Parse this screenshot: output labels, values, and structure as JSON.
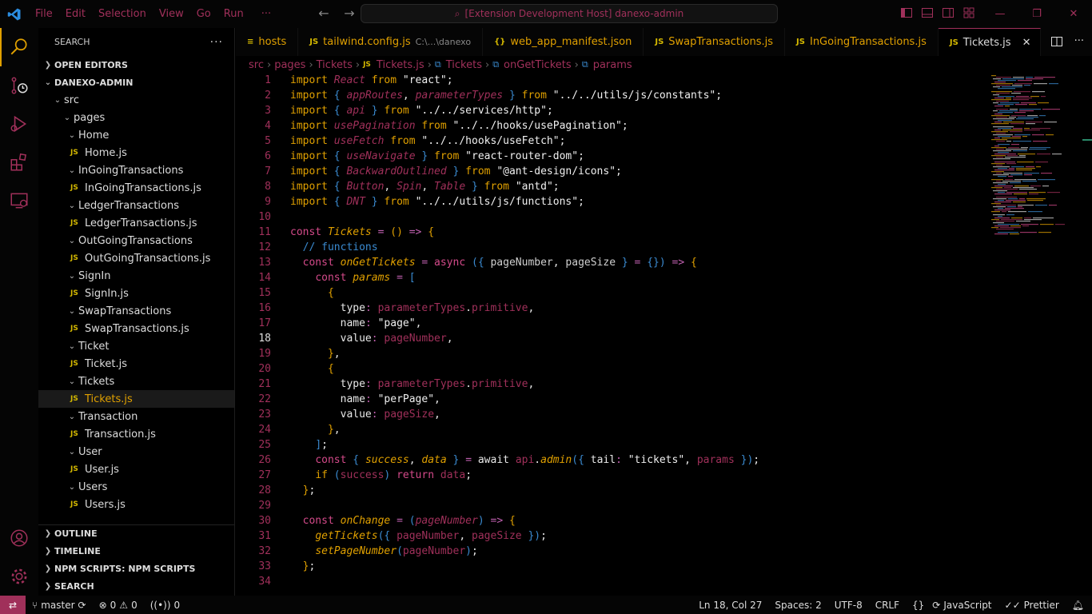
{
  "menu": [
    "File",
    "Edit",
    "Selection",
    "View",
    "Go",
    "Run",
    "···"
  ],
  "command_center": "[Extension Development Host] danexo-admin",
  "sidebar": {
    "title": "SEARCH",
    "open_editors": "OPEN EDITORS",
    "project": "DANEXO-ADMIN",
    "tree": [
      {
        "label": "src",
        "type": "folder",
        "depth": 1
      },
      {
        "label": "pages",
        "type": "folder",
        "depth": 2
      },
      {
        "label": "Home",
        "type": "folder",
        "depth": 3
      },
      {
        "label": "Home.js",
        "type": "file",
        "depth": 4
      },
      {
        "label": "InGoingTransactions",
        "type": "folder",
        "depth": 3
      },
      {
        "label": "InGoingTransactions.js",
        "type": "file",
        "depth": 4
      },
      {
        "label": "LedgerTransactions",
        "type": "folder",
        "depth": 3
      },
      {
        "label": "LedgerTransactions.js",
        "type": "file",
        "depth": 4
      },
      {
        "label": "OutGoingTransactions",
        "type": "folder",
        "depth": 3
      },
      {
        "label": "OutGoingTransactions.js",
        "type": "file",
        "depth": 4
      },
      {
        "label": "SignIn",
        "type": "folder",
        "depth": 3
      },
      {
        "label": "SignIn.js",
        "type": "file",
        "depth": 4
      },
      {
        "label": "SwapTransactions",
        "type": "folder",
        "depth": 3
      },
      {
        "label": "SwapTransactions.js",
        "type": "file",
        "depth": 4
      },
      {
        "label": "Ticket",
        "type": "folder",
        "depth": 3
      },
      {
        "label": "Ticket.js",
        "type": "file",
        "depth": 4
      },
      {
        "label": "Tickets",
        "type": "folder",
        "depth": 3
      },
      {
        "label": "Tickets.js",
        "type": "file",
        "depth": 4,
        "selected": true
      },
      {
        "label": "Transaction",
        "type": "folder",
        "depth": 3
      },
      {
        "label": "Transaction.js",
        "type": "file",
        "depth": 4
      },
      {
        "label": "User",
        "type": "folder",
        "depth": 3
      },
      {
        "label": "User.js",
        "type": "file",
        "depth": 4
      },
      {
        "label": "Users",
        "type": "folder",
        "depth": 3
      },
      {
        "label": "Users.js",
        "type": "file",
        "depth": 4
      }
    ],
    "sections": [
      "OUTLINE",
      "TIMELINE",
      "NPM SCRIPTS: NPM SCRIPTS",
      "SEARCH"
    ]
  },
  "tabs": [
    {
      "icon": "≡",
      "label": "hosts",
      "sub": ""
    },
    {
      "icon": "JS",
      "label": "tailwind.config.js",
      "sub": "C:\\...\\danexo"
    },
    {
      "icon": "{}",
      "label": "web_app_manifest.json",
      "sub": ""
    },
    {
      "icon": "JS",
      "label": "SwapTransactions.js",
      "sub": ""
    },
    {
      "icon": "JS",
      "label": "InGoingTransactions.js",
      "sub": ""
    },
    {
      "icon": "JS",
      "label": "Tickets.js",
      "sub": "",
      "active": true
    }
  ],
  "breadcrumbs": [
    "src",
    "pages",
    "Tickets",
    "Tickets.js",
    "Tickets",
    "onGetTickets",
    "params"
  ],
  "code": {
    "current_line": 18,
    "lines": [
      [
        [
          "kw2",
          "import "
        ],
        [
          "it",
          "React"
        ],
        [
          "kw2",
          " from "
        ],
        [
          "str",
          "\"react\""
        ],
        [
          "id",
          ";"
        ]
      ],
      [
        [
          "kw2",
          "import "
        ],
        [
          "br",
          "{ "
        ],
        [
          "it",
          "appRoutes"
        ],
        [
          "id",
          ", "
        ],
        [
          "it",
          "parameterTypes"
        ],
        [
          "br",
          " }"
        ],
        [
          "kw2",
          " from "
        ],
        [
          "str",
          "\"../../utils/js/constants\""
        ],
        [
          "id",
          ";"
        ]
      ],
      [
        [
          "kw2",
          "import "
        ],
        [
          "br",
          "{ "
        ],
        [
          "it",
          "api"
        ],
        [
          "br",
          " }"
        ],
        [
          "kw2",
          " from "
        ],
        [
          "str",
          "\"../../services/http\""
        ],
        [
          "id",
          ";"
        ]
      ],
      [
        [
          "kw2",
          "import "
        ],
        [
          "it",
          "usePagination"
        ],
        [
          "kw2",
          " from "
        ],
        [
          "str",
          "\"../../hooks/usePagination\""
        ],
        [
          "id",
          ";"
        ]
      ],
      [
        [
          "kw2",
          "import "
        ],
        [
          "it",
          "useFetch"
        ],
        [
          "kw2",
          " from "
        ],
        [
          "str",
          "\"../../hooks/useFetch\""
        ],
        [
          "id",
          ";"
        ]
      ],
      [
        [
          "kw2",
          "import "
        ],
        [
          "br",
          "{ "
        ],
        [
          "it",
          "useNavigate"
        ],
        [
          "br",
          " }"
        ],
        [
          "kw2",
          " from "
        ],
        [
          "str",
          "\"react-router-dom\""
        ],
        [
          "id",
          ";"
        ]
      ],
      [
        [
          "kw2",
          "import "
        ],
        [
          "br",
          "{ "
        ],
        [
          "it",
          "BackwardOutlined"
        ],
        [
          "br",
          " }"
        ],
        [
          "kw2",
          " from "
        ],
        [
          "str",
          "\"@ant-design/icons\""
        ],
        [
          "id",
          ";"
        ]
      ],
      [
        [
          "kw2",
          "import "
        ],
        [
          "br",
          "{ "
        ],
        [
          "it",
          "Button"
        ],
        [
          "id",
          ", "
        ],
        [
          "it",
          "Spin"
        ],
        [
          "id",
          ", "
        ],
        [
          "it",
          "Table"
        ],
        [
          "br",
          " }"
        ],
        [
          "kw2",
          " from "
        ],
        [
          "str",
          "\"antd\""
        ],
        [
          "id",
          ";"
        ]
      ],
      [
        [
          "kw2",
          "import "
        ],
        [
          "br",
          "{ "
        ],
        [
          "it",
          "DNT"
        ],
        [
          "br",
          " }"
        ],
        [
          "kw2",
          " from "
        ],
        [
          "str",
          "\"../../utils/js/functions\""
        ],
        [
          "id",
          ";"
        ]
      ],
      [],
      [
        [
          "kw",
          "const "
        ],
        [
          "fn",
          "Tickets"
        ],
        [
          "op",
          " = "
        ],
        [
          "kw2",
          "() "
        ],
        [
          "op",
          "=> "
        ],
        [
          "kw2",
          "{"
        ]
      ],
      [
        [
          "id",
          "  "
        ],
        [
          "cm",
          "// functions"
        ]
      ],
      [
        [
          "id",
          "  "
        ],
        [
          "kw",
          "const "
        ],
        [
          "fn",
          "onGetTickets"
        ],
        [
          "op",
          " = "
        ],
        [
          "kw",
          "async "
        ],
        [
          "br",
          "({ "
        ],
        [
          "pr",
          "pageNumber"
        ],
        [
          "id",
          ", "
        ],
        [
          "pr",
          "pageSize"
        ],
        [
          "br",
          " } "
        ],
        [
          "op",
          "= "
        ],
        [
          "br",
          "{}"
        ],
        [
          "br",
          ") "
        ],
        [
          "op",
          "=> "
        ],
        [
          "kw2",
          "{"
        ]
      ],
      [
        [
          "id",
          "    "
        ],
        [
          "kw",
          "const "
        ],
        [
          "fn",
          "params"
        ],
        [
          "op",
          " = "
        ],
        [
          "br",
          "["
        ]
      ],
      [
        [
          "id",
          "      "
        ],
        [
          "kw2",
          "{"
        ]
      ],
      [
        [
          "id",
          "        "
        ],
        [
          "id",
          "type"
        ],
        [
          "op",
          ": "
        ],
        [
          "pm",
          "parameterTypes"
        ],
        [
          "id",
          "."
        ],
        [
          "pm",
          "primitive"
        ],
        [
          "id",
          ","
        ]
      ],
      [
        [
          "id",
          "        "
        ],
        [
          "id",
          "name"
        ],
        [
          "op",
          ": "
        ],
        [
          "str",
          "\"page\""
        ],
        [
          "id",
          ","
        ]
      ],
      [
        [
          "id",
          "        "
        ],
        [
          "id",
          "value"
        ],
        [
          "op",
          ": "
        ],
        [
          "pm",
          "pageNumber"
        ],
        [
          "id",
          ","
        ]
      ],
      [
        [
          "id",
          "      "
        ],
        [
          "kw2",
          "}"
        ],
        [
          "id",
          ","
        ]
      ],
      [
        [
          "id",
          "      "
        ],
        [
          "kw2",
          "{"
        ]
      ],
      [
        [
          "id",
          "        "
        ],
        [
          "id",
          "type"
        ],
        [
          "op",
          ": "
        ],
        [
          "pm",
          "parameterTypes"
        ],
        [
          "id",
          "."
        ],
        [
          "pm",
          "primitive"
        ],
        [
          "id",
          ","
        ]
      ],
      [
        [
          "id",
          "        "
        ],
        [
          "id",
          "name"
        ],
        [
          "op",
          ": "
        ],
        [
          "str",
          "\"perPage\""
        ],
        [
          "id",
          ","
        ]
      ],
      [
        [
          "id",
          "        "
        ],
        [
          "id",
          "value"
        ],
        [
          "op",
          ": "
        ],
        [
          "pm",
          "pageSize"
        ],
        [
          "id",
          ","
        ]
      ],
      [
        [
          "id",
          "      "
        ],
        [
          "kw2",
          "}"
        ],
        [
          "id",
          ","
        ]
      ],
      [
        [
          "id",
          "    "
        ],
        [
          "br",
          "]"
        ],
        [
          "id",
          ";"
        ]
      ],
      [
        [
          "id",
          "    "
        ],
        [
          "kw",
          "const "
        ],
        [
          "br",
          "{ "
        ],
        [
          "fn",
          "success"
        ],
        [
          "id",
          ", "
        ],
        [
          "fn",
          "data"
        ],
        [
          "br",
          " } "
        ],
        [
          "op",
          "= "
        ],
        [
          "id",
          "await "
        ],
        [
          "pm",
          "api"
        ],
        [
          "id",
          "."
        ],
        [
          "fn",
          "admin"
        ],
        [
          "br",
          "({ "
        ],
        [
          "id",
          "tail"
        ],
        [
          "op",
          ": "
        ],
        [
          "str",
          "\"tickets\""
        ],
        [
          "id",
          ", "
        ],
        [
          "pm",
          "params"
        ],
        [
          "br",
          " })"
        ],
        [
          "id",
          ";"
        ]
      ],
      [
        [
          "id",
          "    "
        ],
        [
          "kw2",
          "if "
        ],
        [
          "br",
          "("
        ],
        [
          "pm",
          "success"
        ],
        [
          "br",
          ") "
        ],
        [
          "kw",
          "return "
        ],
        [
          "pm",
          "data"
        ],
        [
          "id",
          ";"
        ]
      ],
      [
        [
          "id",
          "  "
        ],
        [
          "kw2",
          "}"
        ],
        [
          "id",
          ";"
        ]
      ],
      [],
      [
        [
          "id",
          "  "
        ],
        [
          "kw",
          "const "
        ],
        [
          "fn",
          "onChange"
        ],
        [
          "op",
          " = "
        ],
        [
          "br",
          "("
        ],
        [
          "it",
          "pageNumber"
        ],
        [
          "br",
          ") "
        ],
        [
          "op",
          "=> "
        ],
        [
          "kw2",
          "{"
        ]
      ],
      [
        [
          "id",
          "    "
        ],
        [
          "fn",
          "getTickets"
        ],
        [
          "br",
          "({ "
        ],
        [
          "pm",
          "pageNumber"
        ],
        [
          "id",
          ", "
        ],
        [
          "pm",
          "pageSize"
        ],
        [
          "br",
          " })"
        ],
        [
          "id",
          ";"
        ]
      ],
      [
        [
          "id",
          "    "
        ],
        [
          "fn",
          "setPageNumber"
        ],
        [
          "br",
          "("
        ],
        [
          "pm",
          "pageNumber"
        ],
        [
          "br",
          ")"
        ],
        [
          "id",
          ";"
        ]
      ],
      [
        [
          "id",
          "  "
        ],
        [
          "kw2",
          "}"
        ],
        [
          "id",
          ";"
        ]
      ],
      []
    ]
  },
  "statusbar": {
    "branch": "master",
    "errors": "0",
    "warnings": "0",
    "ports": "0",
    "position": "Ln 18, Col 27",
    "spaces": "Spaces: 2",
    "encoding": "UTF-8",
    "eol": "CRLF",
    "braces": "{}",
    "language": "JavaScript",
    "formatter": "Prettier"
  },
  "colors": {
    "accent": "#a0305a",
    "keyword": "#e0a000",
    "bracket": "#3a8ad0"
  }
}
